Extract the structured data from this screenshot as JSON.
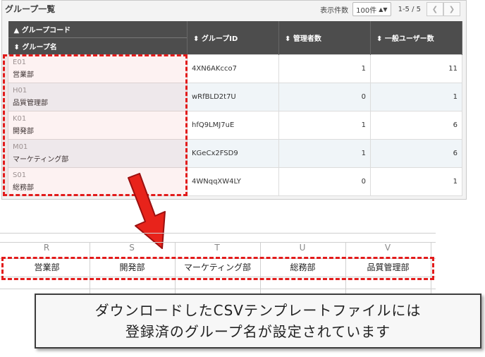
{
  "panel": {
    "title": "グループ一覧",
    "pager": {
      "label": "表示件数",
      "per_page": "100件",
      "range": "1-5 / 5"
    }
  },
  "table": {
    "headers": {
      "group_code": "グループコード",
      "group_name": "グループ名",
      "group_id": "グループID",
      "admins": "管理者数",
      "users": "一般ユーザー数"
    },
    "rows": [
      {
        "code": "E01",
        "name": "営業部",
        "id": "4XN6AKcco7",
        "admins": "1",
        "users": "11"
      },
      {
        "code": "H01",
        "name": "品質管理部",
        "id": "wRfBLD2t7U",
        "admins": "0",
        "users": "1"
      },
      {
        "code": "K01",
        "name": "開発部",
        "id": "hfQ9LMJ7uE",
        "admins": "1",
        "users": "6"
      },
      {
        "code": "M01",
        "name": "マーケティング部",
        "id": "KGeCx2FSD9",
        "admins": "1",
        "users": "6"
      },
      {
        "code": "S01",
        "name": "総務部",
        "id": "4WNqqXW4LY",
        "admins": "0",
        "users": "1"
      }
    ]
  },
  "spreadsheet": {
    "columns": [
      "R",
      "S",
      "T",
      "U",
      "V"
    ],
    "cells": [
      "営業部",
      "開発部",
      "マーケティング部",
      "総務部",
      "品質管理部"
    ]
  },
  "callout": {
    "line1": "ダウンロードしたCSVテンプレートファイルには",
    "line2": "登録済のグループ名が設定されています"
  },
  "colors": {
    "accent": "#e21b1b",
    "header": "#4d4d4d"
  }
}
